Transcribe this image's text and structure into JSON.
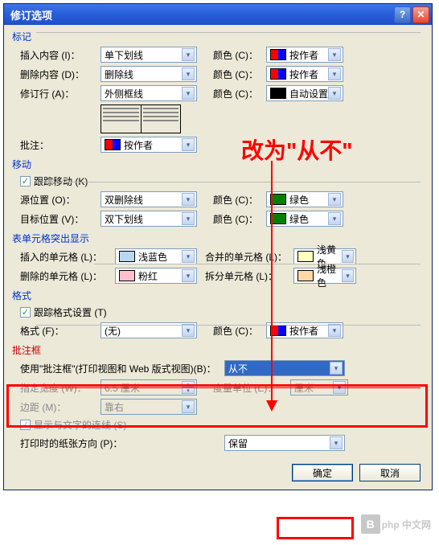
{
  "titlebar": {
    "title": "修订选项"
  },
  "sections": {
    "mark": "标记",
    "move": "移动",
    "table": "表单元格突出显示",
    "format": "格式",
    "balloon": "批注框"
  },
  "labels": {
    "insert": "插入内容 (I)：",
    "delete": "删除内容 (D)：",
    "revline": "修订行 (A)：",
    "comment": "批注：",
    "trackmove": "跟踪移动 (K)",
    "sourcepos": "源位置 (O)：",
    "targetpos": "目标位置 (V)：",
    "insertcell": "插入的单元格 (L)：",
    "deletecell": "删除的单元格 (L)：",
    "mergecell": "合并的单元格 (L)：",
    "splitcell": "拆分单元格 (L)：",
    "trackformat": "跟踪格式设置 (T)",
    "format": "格式 (F)：",
    "useballoon": "使用\"批注框\"(打印视图和 Web 版式视图)(B)：",
    "preferwidth": "指定宽度 (W)：",
    "measure": "度量单位 (E)：",
    "margin": "边距 (M)：",
    "showlines": "显示与文字的连线 (S)",
    "printorient": "打印时的纸张方向 (P)：",
    "color": "颜色 (C)："
  },
  "values": {
    "insert": "单下划线",
    "delete": "删除线",
    "revline": "外侧框线",
    "comment": "按作者",
    "sourcepos": "双删除线",
    "targetpos": "双下划线",
    "insertcell": "浅蓝色",
    "deletecell": "粉红",
    "mergecell": "浅黄色",
    "splitcell": "浅橙色",
    "format": "(无)",
    "useballoon": "从不",
    "preferwidth": "6.5 厘米",
    "measure": "厘米",
    "margin": "靠右",
    "printorient": "保留",
    "byauthor": "按作者",
    "autoset": "自动设置",
    "green": "绿色"
  },
  "buttons": {
    "ok": "确定",
    "cancel": "取消"
  },
  "annotation": {
    "text": "改为\"从不\""
  },
  "watermark": {
    "text": "php 中文网"
  }
}
